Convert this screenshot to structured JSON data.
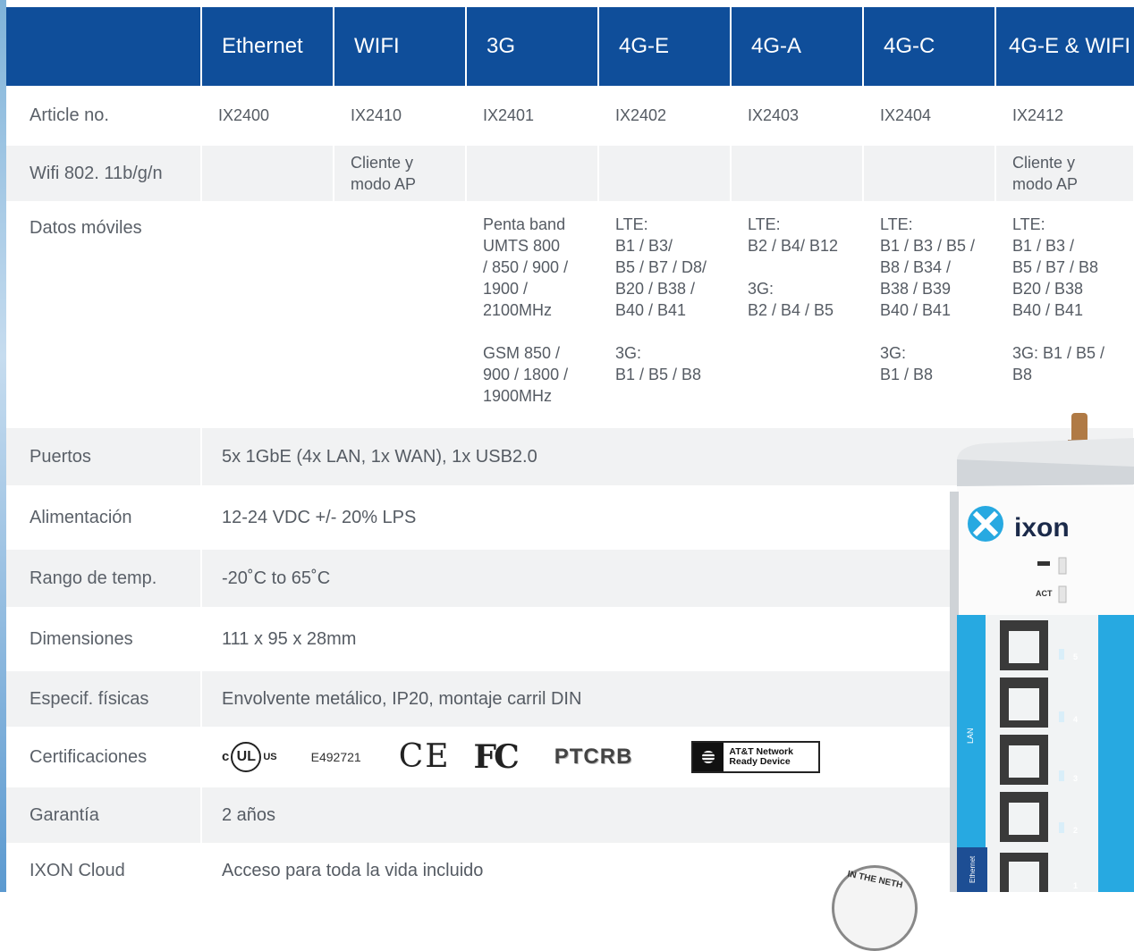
{
  "header": {
    "columns": [
      "Ethernet",
      "WIFI",
      "3G",
      "4G-E",
      "4G-A",
      "4G-C",
      "4G-E & WIFI"
    ]
  },
  "rows": {
    "article": {
      "label": "Article no.",
      "values": [
        "IX2400",
        "IX2410",
        "IX2401",
        "IX2402",
        "IX2403",
        "IX2404",
        "IX2412"
      ]
    },
    "wifi": {
      "label": "Wifi 802. 11b/g/n",
      "values": [
        "",
        "Cliente y\nmodo AP",
        "",
        "",
        "",
        "",
        "Cliente y\nmodo AP"
      ]
    },
    "mobile": {
      "label": "Datos móviles",
      "values": [
        "",
        "",
        "Penta band\nUMTS 800\n/ 850 / 900 /\n1900 /\n2100MHz\n\nGSM 850 /\n900 / 1800 /\n1900MHz",
        "LTE:\nB1 / B3/\nB5 / B7 / D8/\nB20 / B38 /\nB40 / B41\n\n3G:\nB1 / B5 / B8",
        "LTE:\nB2 / B4/ B12\n\n3G:\nB2 / B4 / B5",
        "LTE:\nB1 / B3 / B5 /\nB8 / B34 /\nB38 / B39\nB40 / B41\n\n3G:\nB1 / B8",
        "LTE:\nB1 / B3 /\nB5 /  B7 / B8\nB20 / B38\nB40 / B41\n\n3G: B1 / B5 /\nB8"
      ]
    },
    "ports": {
      "label": "Puertos",
      "value": "5x 1GbE (4x LAN, 1x WAN), 1x USB2.0"
    },
    "power": {
      "label": "Alimentación",
      "value": "12-24 VDC +/- 20% LPS"
    },
    "temp": {
      "label": "Rango de temp.",
      "value": "-20˚C to 65˚C"
    },
    "dims": {
      "label": "Dimensiones",
      "value": "111 x 95 x 28mm"
    },
    "physical": {
      "label": "Especif. físicas",
      "value": "Envolvente metálico, IP20, montaje carril DIN"
    },
    "certs": {
      "label": "Certificaciones",
      "ul_c": "c",
      "ul_mark": "UL",
      "ul_us": "US",
      "ul_number": "E492721",
      "ce": "CE",
      "fc": "FC",
      "ptcrb": "PTCRB",
      "att_line1": "AT&T Network",
      "att_line2": "Ready Device"
    },
    "warranty": {
      "label": "Garantía",
      "value": "2 años"
    },
    "cloud": {
      "label": "IXON Cloud",
      "value": "Acceso para toda la vida incluido"
    }
  },
  "device": {
    "brand": "ixon",
    "led_act": "ACT",
    "port_group_label": "LAN",
    "wan_label": "Ethernet",
    "port_numbers": [
      "5",
      "4",
      "3",
      "2",
      "1"
    ],
    "accent": "#27a9e1"
  },
  "badge_text": "IN THE NETH",
  "colors": {
    "header": "#0f4e9a",
    "row_gray": "#f1f2f3",
    "text": "#555b63"
  }
}
